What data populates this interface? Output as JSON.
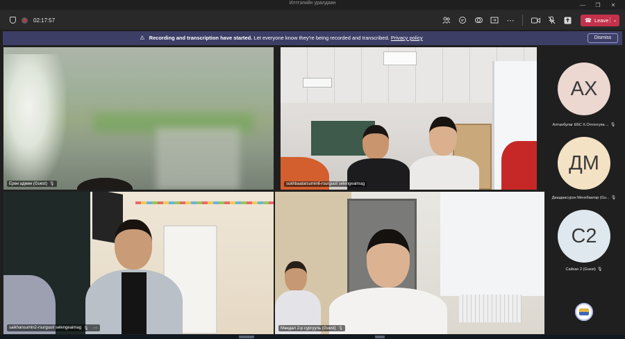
{
  "window": {
    "title": "Илтгэлийн уралдаан"
  },
  "toolbar": {
    "timer": "02:17:57",
    "leave_label": "Leave"
  },
  "banner": {
    "bold_text": "Recording and transcription have started.",
    "body_text": "Let everyone know they're being recorded and transcribed.",
    "link_text": "Privacy policy",
    "dismiss_label": "Dismiss"
  },
  "tiles": [
    {
      "label": "Ерөн админ (Guest)"
    },
    {
      "label": "sukhbaatarsumin6-rsurguuli selengeaimag"
    },
    {
      "label": "saikhansumin2-rsurguuli selengeaimag"
    },
    {
      "label": "Мандал 2-р сургууль (Guest)"
    }
  ],
  "roster": [
    {
      "initials": "АХ",
      "name": "Алтанбулаг ЕБС Х.Отгонтуяа ...",
      "color": "#ecd8d1"
    },
    {
      "initials": "ДМ",
      "name": "Дашдаасүрэн Менхбаатар (Gu...",
      "color": "#f4e2c4"
    },
    {
      "initials": "С2",
      "name": "Сайхан 2 (Guest)",
      "color": "#dfe8ee"
    }
  ],
  "icons": {
    "toolbar": [
      "people-icon",
      "chat-icon",
      "react-icon",
      "share-icon",
      "more-icon",
      "camera-icon",
      "mic-off-icon",
      "share-tray-icon"
    ]
  },
  "colors": {
    "leave": "#c4314b",
    "banner": "#3d3e66"
  }
}
